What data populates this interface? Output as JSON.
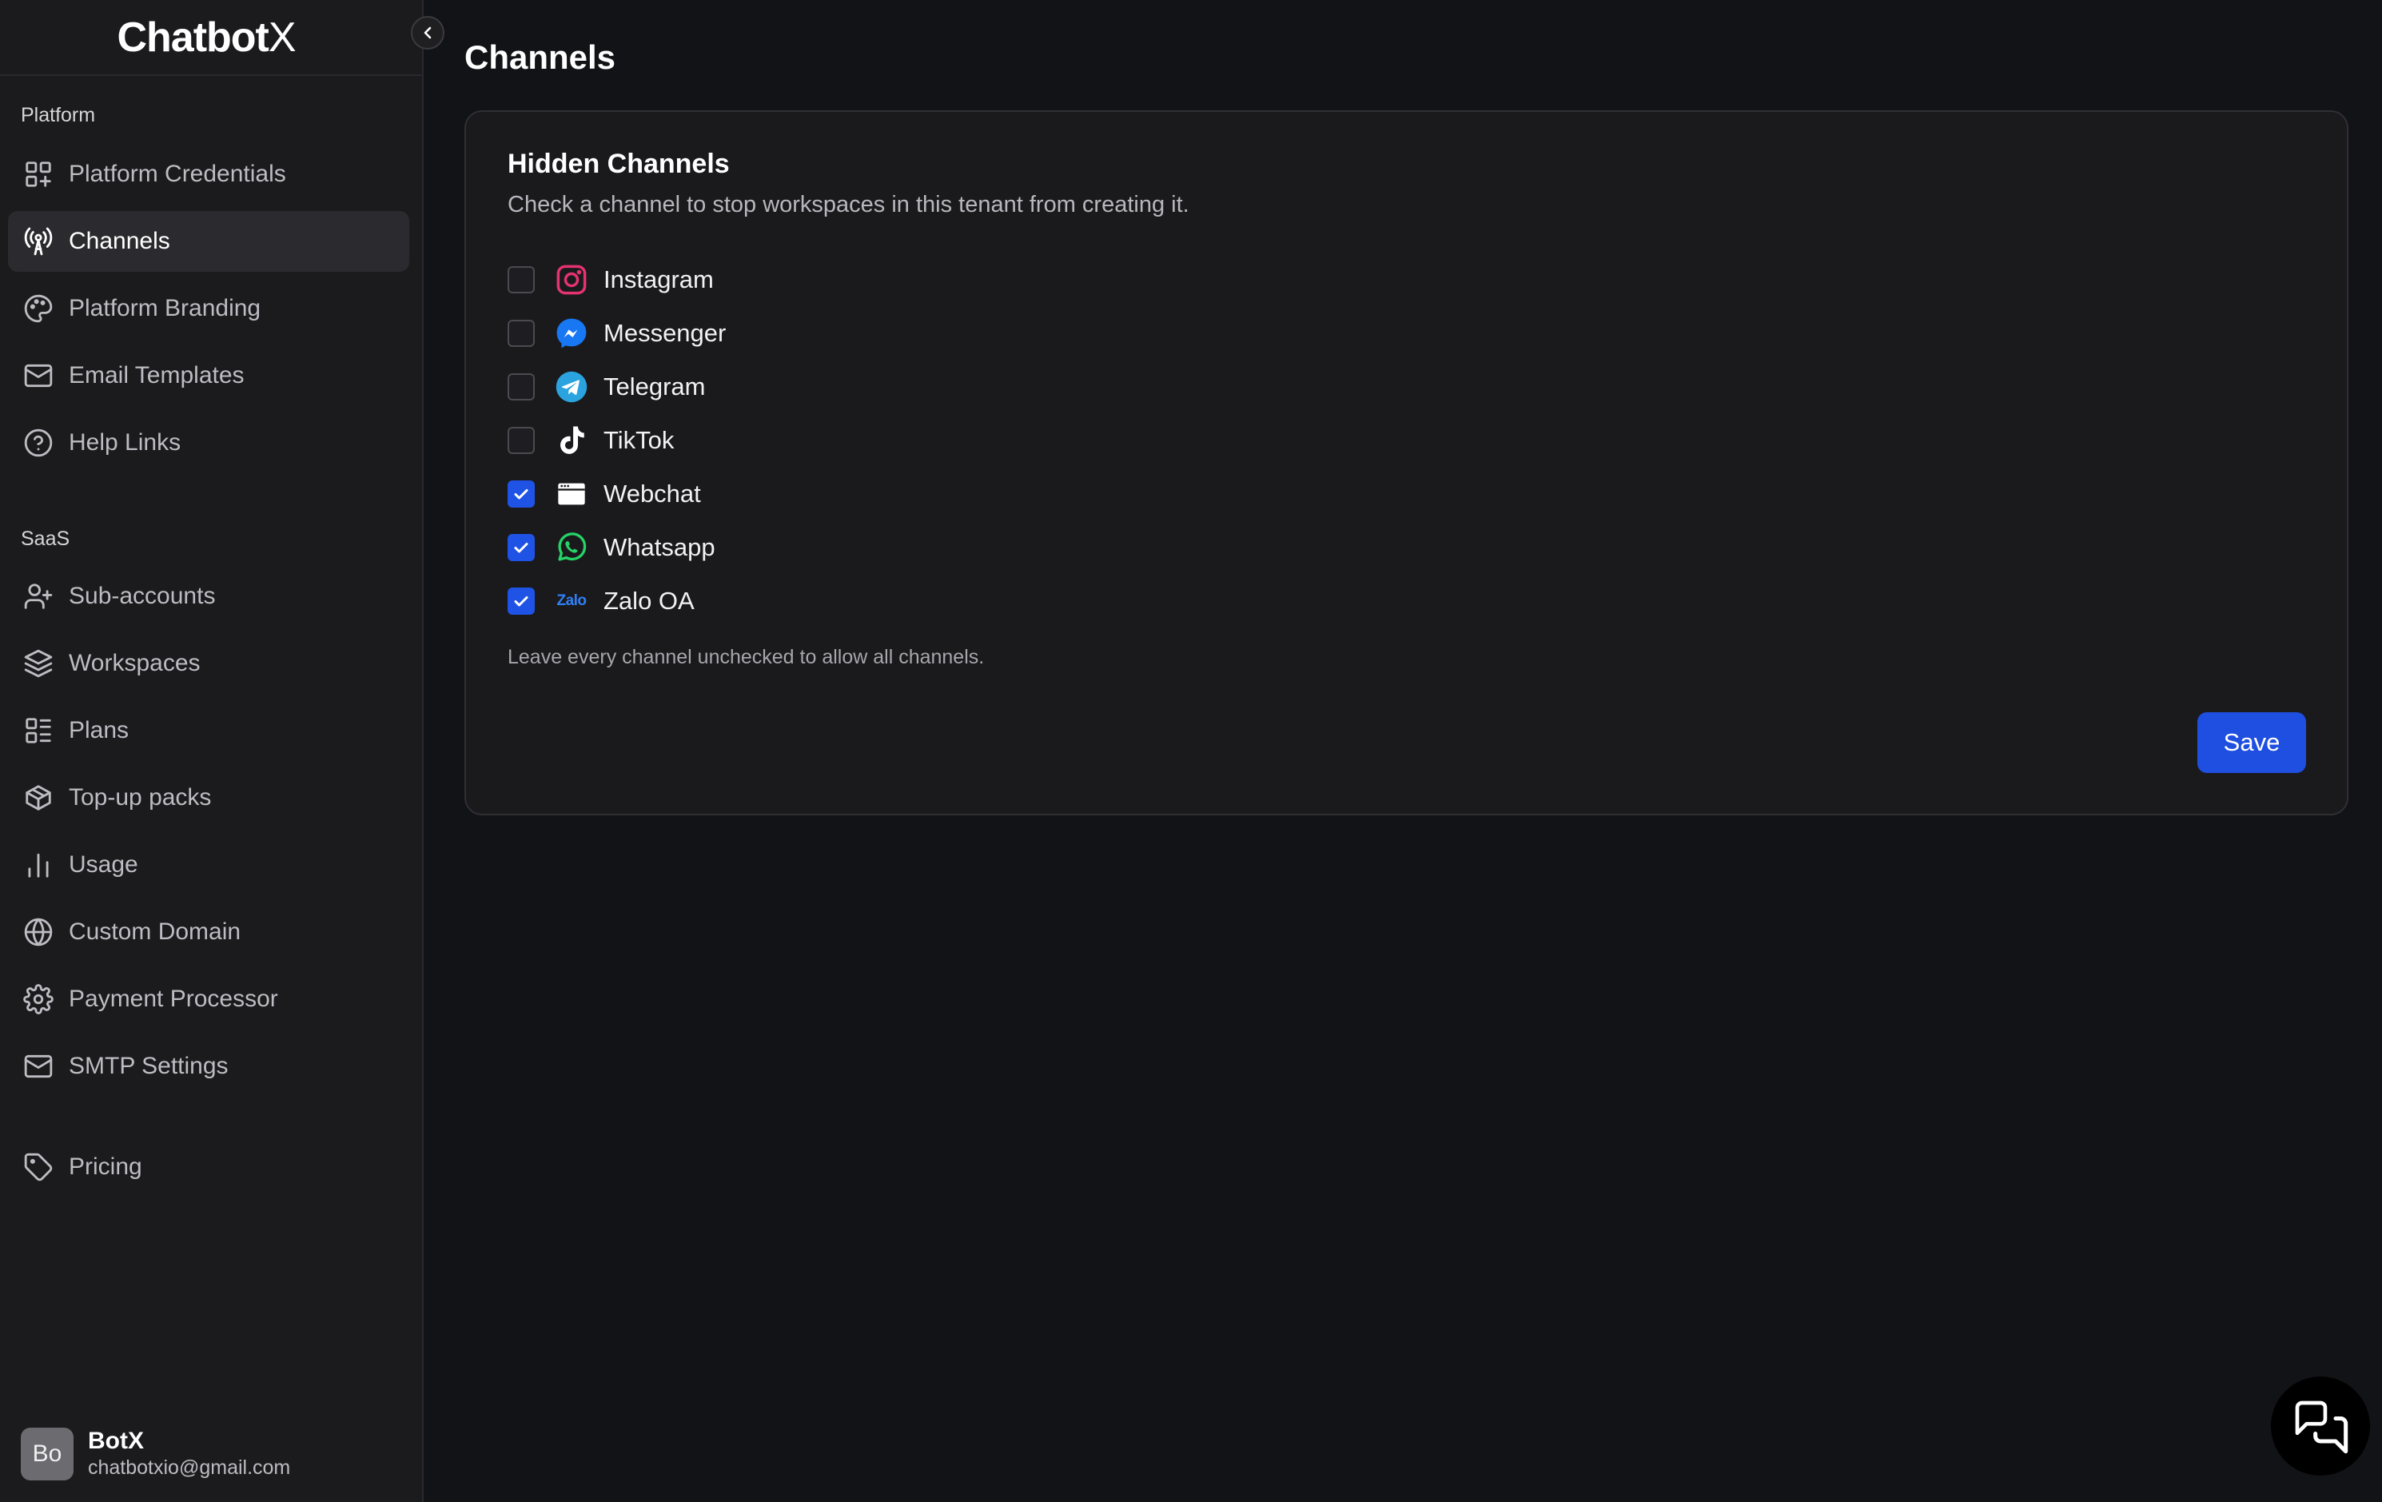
{
  "brand": {
    "name": "Chatbot",
    "suffix": "X"
  },
  "sidebar": {
    "sections": [
      {
        "label": "Platform"
      },
      {
        "label": "SaaS"
      }
    ],
    "items": [
      {
        "label": "Platform Credentials",
        "icon": "grid-plus-icon"
      },
      {
        "label": "Channels",
        "icon": "radio-tower-icon",
        "active": true
      },
      {
        "label": "Platform Branding",
        "icon": "palette-icon"
      },
      {
        "label": "Email Templates",
        "icon": "mail-icon"
      },
      {
        "label": "Help Links",
        "icon": "help-circle-icon"
      },
      {
        "label": "Sub-accounts",
        "icon": "user-plus-icon"
      },
      {
        "label": "Workspaces",
        "icon": "layers-icon"
      },
      {
        "label": "Plans",
        "icon": "list-icon"
      },
      {
        "label": "Top-up packs",
        "icon": "package-icon"
      },
      {
        "label": "Usage",
        "icon": "bar-chart-icon"
      },
      {
        "label": "Custom Domain",
        "icon": "globe-icon"
      },
      {
        "label": "Payment Processor",
        "icon": "gear-icon"
      },
      {
        "label": "SMTP Settings",
        "icon": "mail-icon"
      },
      {
        "label": "Pricing",
        "icon": "tag-icon"
      }
    ]
  },
  "user": {
    "initials": "Bo",
    "name": "BotX",
    "email": "chatbotxio@gmail.com"
  },
  "page": {
    "title": "Channels"
  },
  "card": {
    "title": "Hidden Channels",
    "subtitle": "Check a channel to stop workspaces in this tenant from creating it.",
    "channels": [
      {
        "label": "Instagram",
        "checked": false,
        "icon": "instagram-icon"
      },
      {
        "label": "Messenger",
        "checked": false,
        "icon": "messenger-icon"
      },
      {
        "label": "Telegram",
        "checked": false,
        "icon": "telegram-icon"
      },
      {
        "label": "TikTok",
        "checked": false,
        "icon": "tiktok-icon"
      },
      {
        "label": "Webchat",
        "checked": true,
        "icon": "webchat-icon"
      },
      {
        "label": "Whatsapp",
        "checked": true,
        "icon": "whatsapp-icon"
      },
      {
        "label": "Zalo OA",
        "checked": true,
        "icon": "zalo-icon",
        "icon_text": "Zalo"
      }
    ],
    "hint": "Leave every channel unchecked to allow all channels.",
    "save_label": "Save"
  },
  "colors": {
    "accent": "#1f4fe0",
    "background": "#121317",
    "sidebar": "#1b1b1e"
  }
}
